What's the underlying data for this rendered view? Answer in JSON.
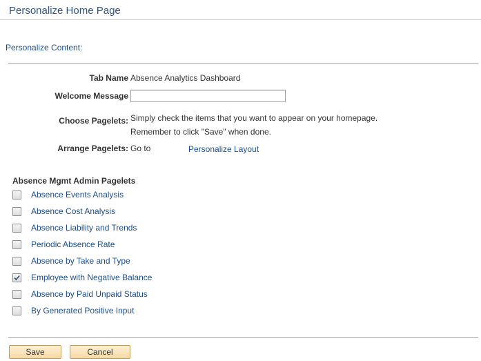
{
  "page": {
    "title": "Personalize Home Page"
  },
  "section": {
    "link": "Personalize Content:"
  },
  "form": {
    "tab_name_label": "Tab Name",
    "tab_name_value": "Absence Analytics Dashboard",
    "welcome_label": "Welcome Message",
    "welcome_value": "",
    "choose_label": "Choose Pagelets:",
    "choose_text_1": "Simply check the items that you want to appear on your homepage.",
    "choose_text_2": "Remember to click \"Save\" when done.",
    "arrange_label": "Arrange Pagelets:",
    "arrange_text": "Go to",
    "arrange_link": "Personalize Layout"
  },
  "pagelets": {
    "heading": "Absence Mgmt Admin Pagelets",
    "items": [
      {
        "label": "Absence Events Analysis",
        "checked": false
      },
      {
        "label": "Absence Cost Analysis",
        "checked": false
      },
      {
        "label": "Absence Liability and Trends",
        "checked": false
      },
      {
        "label": "Periodic Absence Rate",
        "checked": false
      },
      {
        "label": "Absence by Take and Type",
        "checked": false
      },
      {
        "label": "Employee with Negative Balance",
        "checked": true
      },
      {
        "label": "Absence by Paid Unpaid Status",
        "checked": false
      },
      {
        "label": "By Generated Positive Input",
        "checked": false
      }
    ]
  },
  "buttons": {
    "save": "Save",
    "cancel": "Cancel"
  }
}
